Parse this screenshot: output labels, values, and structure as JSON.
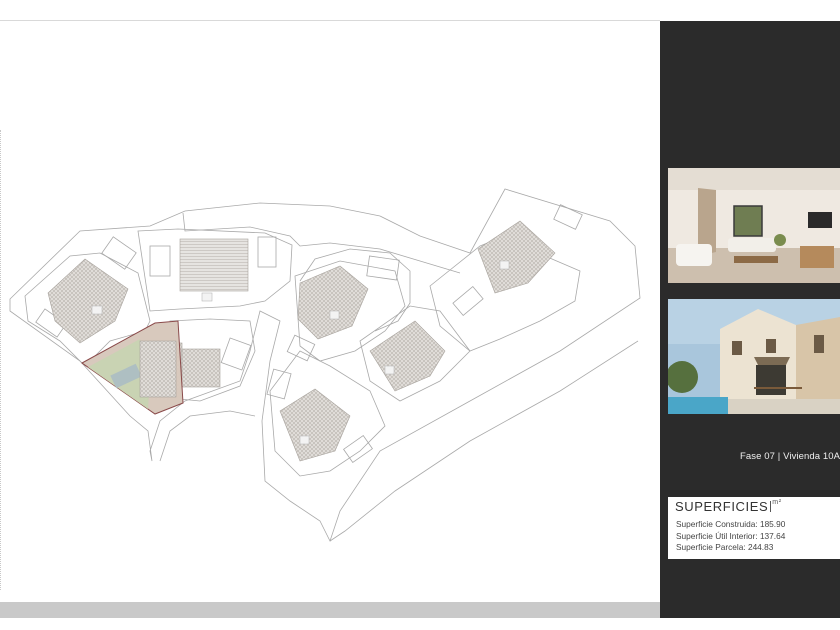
{
  "caption": {
    "phase": "Fase 07",
    "unit": "Vivienda 10A"
  },
  "superficies": {
    "title": "SUPERFICIES",
    "unit": "m²",
    "rows": [
      {
        "label": "Superficie Construida:",
        "value": "185.90"
      },
      {
        "label": "Superficie Útil Interior:",
        "value": "137.64"
      },
      {
        "label": "Superficie Parcela:",
        "value": "244.83"
      }
    ]
  },
  "colors": {
    "panel": "#2b2b2b",
    "highlight": "#d8c9bd",
    "garden": "#c9d3b3"
  }
}
